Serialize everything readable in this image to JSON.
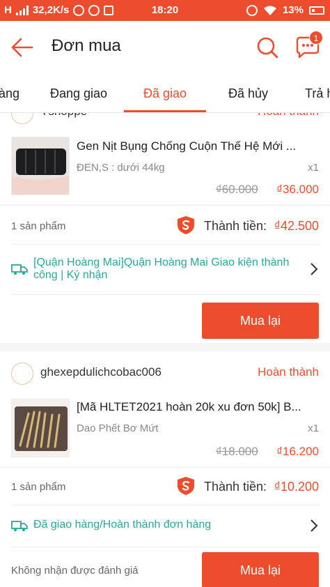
{
  "status_bar": {
    "network_type": "H",
    "speed": "32,2K/s",
    "time": "18:20",
    "battery": "13%"
  },
  "header": {
    "title": "Đơn mua",
    "chat_badge_count": "1"
  },
  "tabs": [
    {
      "label": "àng",
      "active": false
    },
    {
      "label": "Đang giao",
      "active": false
    },
    {
      "label": "Đã giao",
      "active": true
    },
    {
      "label": "Đã hủy",
      "active": false
    },
    {
      "label": "Trả h",
      "active": false
    }
  ],
  "orders": [
    {
      "shop_name": "Yshoppe",
      "status": "Hoàn thành",
      "product_name": "Gen Nịt Bụng Chống Cuộn Thế Hệ Mới ...",
      "variant": "ĐEN,S : dưới 44kg",
      "quantity": "x1",
      "original_price": "₫60.000",
      "price": "₫36.000",
      "item_count": "1 sản phẩm",
      "total_label": "Thành tiền:",
      "total": "₫42.500",
      "shipping_status": "[Quận Hoàng Mai]Quận Hoàng Mai Giao kiện thành công | Ký nhận",
      "rebuy_label": "Mua lại"
    },
    {
      "shop_name": "ghexepdulichcobac006",
      "status": "Hoàn thành",
      "product_name": "[Mã HLTET2021 hoàn 20k xu đơn 50k] B...",
      "variant": "Dao Phết Bơ Mứt",
      "quantity": "x1",
      "original_price": "₫18.000",
      "price": "₫16.200",
      "item_count": "1 sản phẩm",
      "total_label": "Thành tiền:",
      "total": "₫10.200",
      "shipping_status": "Đã giao hàng/Hoàn thành đơn hàng",
      "review_note": "Không nhận được đánh giá",
      "rebuy_label": "Mua lại"
    }
  ],
  "colors": {
    "accent": "#ee4d2d",
    "shipping": "#26aa99"
  }
}
